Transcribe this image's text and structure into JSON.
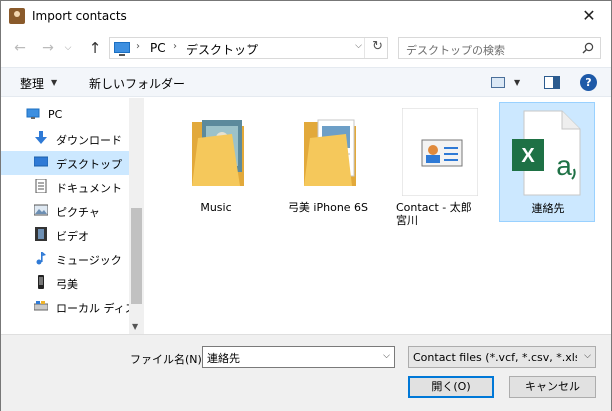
{
  "window": {
    "title": "Import contacts",
    "close_glyph": "✕"
  },
  "address": {
    "breadcrumbs": [
      "PC",
      "デスクトップ"
    ],
    "separator": "›",
    "dropdown": "⌵",
    "refresh": "↻"
  },
  "search": {
    "placeholder": "デスクトップの検索"
  },
  "toolbar": {
    "organize_label": "整理",
    "organize_caret": "▼",
    "new_folder_label": "新しいフォルダー",
    "view_caret": "▼",
    "help_label": "?"
  },
  "nav": {
    "back": "←",
    "forward": "→",
    "recent": "⌵",
    "up": "↑",
    "items": [
      {
        "label": "PC",
        "icon": "pc-icon"
      },
      {
        "label": "ダウンロード",
        "icon": "download-icon"
      },
      {
        "label": "デスクトップ",
        "icon": "desktop-icon",
        "selected": true
      },
      {
        "label": "ドキュメント",
        "icon": "document-icon"
      },
      {
        "label": "ピクチャ",
        "icon": "picture-icon"
      },
      {
        "label": "ビデオ",
        "icon": "video-icon"
      },
      {
        "label": "ミュージック",
        "icon": "music-icon"
      },
      {
        "label": "弓美",
        "icon": "phone-icon"
      },
      {
        "label": "ローカル ディスク",
        "icon": "drive-icon"
      }
    ],
    "scroll_down": "▼"
  },
  "files": [
    {
      "label": "Music",
      "icon": "folder-icon"
    },
    {
      "label": "弓美 iPhone 6S",
      "icon": "folder-icon"
    },
    {
      "label": "Contact - 太郎 宮川",
      "icon": "contact-card-icon"
    },
    {
      "label": "連絡先",
      "icon": "excel-icon",
      "selected": true
    }
  ],
  "bottom": {
    "filename_label": "ファイル名(N):",
    "filename_value": "連絡先",
    "filename_caret": "⌵",
    "filetype_value": "Contact files (*.vcf, *.csv, *.xls, *",
    "filetype_caret": "⌵",
    "open_label": "開く(O)",
    "cancel_label": "キャンセル"
  },
  "colors": {
    "accent": "#0078d7",
    "selection": "#cce8ff",
    "folder": "#f5c85b",
    "excel": "#1e7145"
  }
}
